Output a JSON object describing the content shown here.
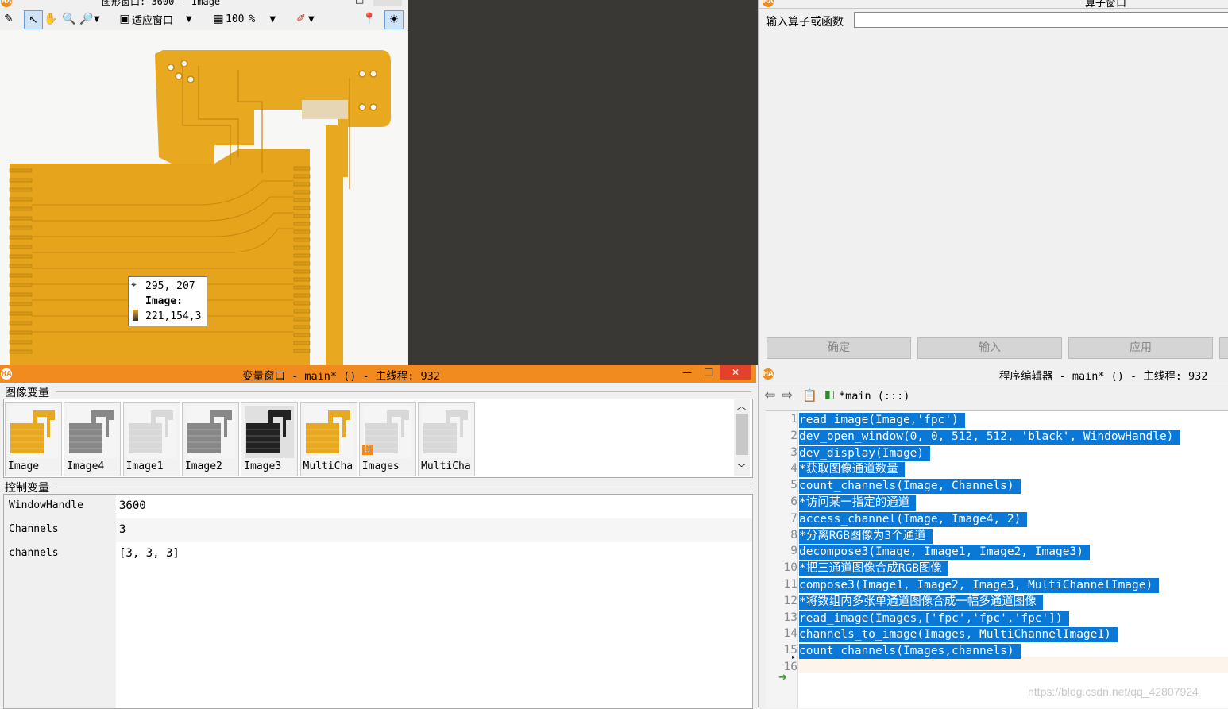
{
  "graphics_window": {
    "title": "图形窗口: 3600 - Image",
    "fit_window_label": "适应窗口",
    "zoom_value": "100",
    "zoom_unit": "%",
    "tooltip": {
      "coords": "295, 207",
      "image_label": "Image:",
      "pixel_value": "221,154,3"
    }
  },
  "operator_window": {
    "title": "算子窗口",
    "input_label": "输入算子或函数",
    "input_value": "",
    "buttons": {
      "ok": "确定",
      "enter": "输入",
      "apply": "应用"
    }
  },
  "variable_window": {
    "title": "变量窗口 - main* () - 主线程: 932",
    "iconic_section": "图像变量",
    "control_section": "控制变量",
    "thumbnails": [
      "Image",
      "Image4",
      "Image1",
      "Image2",
      "Image3",
      "MultiCha",
      "Images",
      "MultiCha"
    ],
    "control_vars": [
      {
        "name": "WindowHandle",
        "value": "3600"
      },
      {
        "name": "Channels",
        "value": "3"
      },
      {
        "name": "channels",
        "value": "[3, 3, 3]"
      }
    ]
  },
  "program_editor": {
    "title": "程序编辑器 - main* () - 主线程: 932",
    "procedure": "*main (:::)",
    "lines": [
      "read_image(Image,'fpc')",
      "dev_open_window(0, 0, 512, 512, 'black', WindowHandle)",
      "dev_display(Image)",
      "*获取图像通道数量",
      "count_channels(Image, Channels)",
      "*访问某一指定的通道",
      "access_channel(Image, Image4, 2)",
      "*分离RGB图像为3个通道",
      "decompose3(Image, Image1, Image2, Image3)",
      "*把三通道图像合成RGB图像",
      "compose3(Image1, Image2, Image3, MultiChannelImage)",
      "*将数组内多张单通道图像合成一幅多通道图像",
      "read_image(Images,['fpc','fpc','fpc'])",
      "channels_to_image(Images, MultiChannelImage1)",
      "count_channels(Images,channels)",
      ""
    ],
    "line_numbers": [
      "1",
      "2",
      "3",
      "4",
      "5",
      "6",
      "7",
      "8",
      "9",
      "10",
      "11",
      "12",
      "13",
      "14",
      "15",
      "16"
    ]
  },
  "watermark": "https://blog.csdn.net/qq_42807924",
  "colors": {
    "accent_orange": "#f28b1f",
    "selection_blue": "#0a78d7",
    "fpc_yellow": "#e8a820"
  }
}
